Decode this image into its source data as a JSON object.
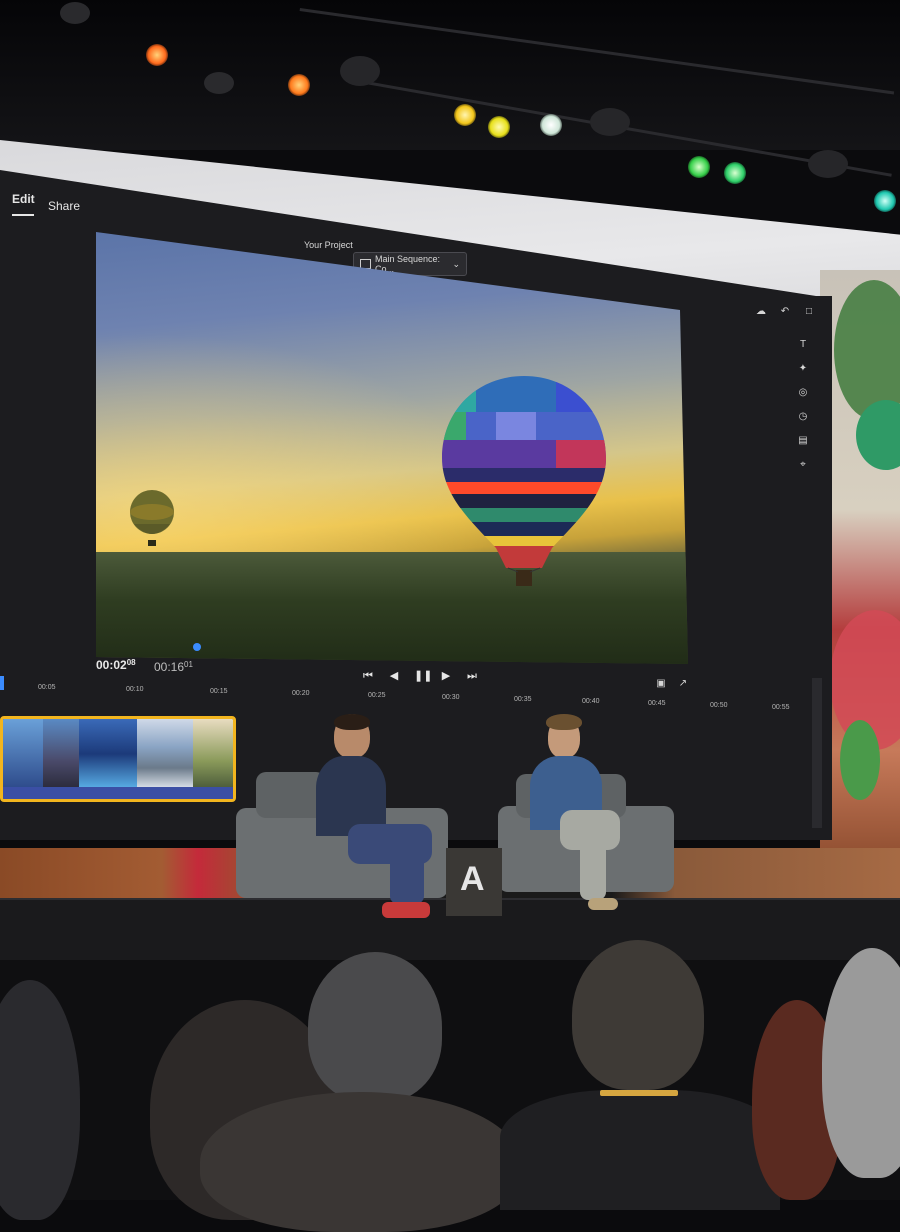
{
  "app": {
    "tabs": [
      {
        "label": "Edit",
        "active": true
      },
      {
        "label": "Share",
        "active": false
      }
    ],
    "project": {
      "label": "Your Project",
      "sequence": "Main Sequence: Co..."
    },
    "playback": {
      "current_time": "00:02",
      "current_frames": "08",
      "total_time": "00:16",
      "total_frames": "01"
    },
    "ruler_ticks": [
      "00:05",
      "00:10",
      "00:15",
      "00:20",
      "00:25",
      "00:30",
      "00:35",
      "00:40",
      "00:45",
      "00:50",
      "00:55"
    ],
    "icons": {
      "top": [
        "cloud-icon",
        "undo-icon",
        "comment-icon"
      ],
      "side": [
        "text-icon",
        "effects-icon",
        "color-icon",
        "speed-icon",
        "audio-icon",
        "transform-icon"
      ],
      "transport": [
        "skip-back-icon",
        "step-back-icon",
        "pause-icon",
        "step-forward-icon",
        "skip-forward-icon"
      ],
      "viewer": [
        "fit-icon",
        "export-icon"
      ]
    },
    "accent_color": "#3b8cff",
    "clip_highlight_color": "#f2b51e"
  },
  "stage": {
    "logo_glyph": "A"
  }
}
